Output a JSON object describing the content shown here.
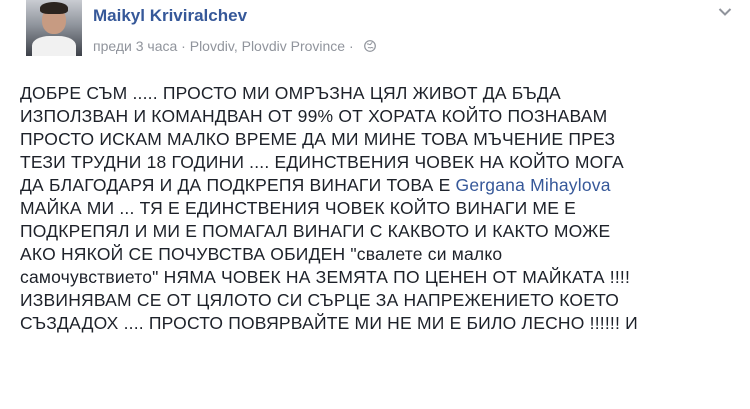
{
  "post": {
    "author": "Maikyl Kriviralchev",
    "time": "преди 3 часа",
    "separator": "·",
    "location": "Plovdiv, Plovdiv Province",
    "privacy_icon": "globe-icon",
    "menu_icon": "chevron-down-icon",
    "text_before_mention": "ДОБРЕ СЪМ ..... ПРОСТО МИ ОМРЪЗНА ЦЯЛ ЖИВОТ ДА БЪДА\nИЗПОЛЗВАН И КОМАНДВАН ОТ 99% ОТ ХОРАТА КОЙТО ПОЗНАВАМ\nПРОСТО ИСКАМ МАЛКО ВРЕМЕ ДА МИ МИНЕ ТОВА МЪЧЕНИЕ ПРЕЗ\nТЕЗИ ТРУДНИ 18 ГОДИНИ .... ЕДИНСТВЕНИЯ ЧОВЕК НА КОЙТО МОГА\nДА БЛАГОДАРЯ И ДА ПОДКРЕПЯ ВИНАГИ ТОВА Е ",
    "mention": "Gergana Mihaylova",
    "text_after_mention": "\nМАЙКА МИ ... ТЯ Е ЕДИНСТВЕНИЯ ЧОВЕК КОЙТО ВИНАГИ МЕ Е\nПОДКРЕПЯЛ И МИ Е ПОМАГАЛ ВИНАГИ С КАКВОТО И КАКТО МОЖЕ\nАКО НЯКОЙ СЕ ПОЧУВСТВА ОБИДЕН \"свалете си малко\nсамочувствието\" НЯМА ЧОВЕК НА ЗЕМЯТА ПО ЦЕНЕН ОТ МАЙКАТА !!!!\nИЗВИНЯВАМ СЕ ОТ ЦЯЛОТО СИ СЪРЦЕ ЗА НАПРЕЖЕНИЕТО КОЕТО\nСЪЗДАДОХ .... ПРОСТО ПОВЯРВАЙТЕ МИ НЕ МИ Е БИЛО ЛЕСНО !!!!!! И"
  },
  "colors": {
    "link": "#365899",
    "meta": "#90949c",
    "text": "#1d2129"
  }
}
